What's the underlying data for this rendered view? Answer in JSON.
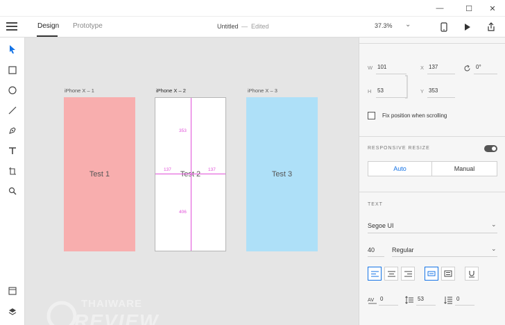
{
  "window": {
    "minimize_glyph": "—",
    "maximize_glyph": "☐",
    "close_glyph": "✕"
  },
  "toolbar": {
    "tabs": [
      {
        "label": "Design"
      },
      {
        "label": "Prototype"
      }
    ],
    "document_title": "Untitled",
    "title_separator": "—",
    "document_status": "Edited",
    "zoom": "37.3%",
    "zoom_chevron": "⌄"
  },
  "tools": [
    "select-icon",
    "rectangle-icon",
    "ellipse-icon",
    "line-icon",
    "pen-icon",
    "text-icon",
    "artboard-icon",
    "zoom-icon",
    "assets-icon",
    "layers-icon"
  ],
  "canvas": {
    "artboards": [
      {
        "name": "iPhone X – 1",
        "text": "Test 1",
        "color": "#f8aeae"
      },
      {
        "name": "iPhone X – 2",
        "text": "Test 2",
        "color": "#ffffff"
      },
      {
        "name": "iPhone X – 3",
        "text": "Test 3",
        "color": "#aee0f8"
      }
    ],
    "measurements": {
      "top": "353",
      "left": "137",
      "right": "137",
      "bottom": "406"
    },
    "guide_color": "#e14fd8"
  },
  "watermark": {
    "top": "THAIWARE",
    "bottom": "REVIEW"
  },
  "properties": {
    "w_label": "W",
    "w_value": "101",
    "x_label": "X",
    "x_value": "137",
    "rotation_value": "0°",
    "h_label": "H",
    "h_value": "53",
    "y_label": "Y",
    "y_value": "353",
    "fix_position_label": "Fix position when scrolling",
    "fix_position_checked": false,
    "responsive_heading": "RESPONSIVE RESIZE",
    "responsive_enabled": true,
    "resize_auto": "Auto",
    "resize_manual": "Manual",
    "text_heading": "TEXT",
    "font_family": "Segoe UI",
    "font_size": "40",
    "font_weight": "Regular",
    "char_spacing": "0",
    "line_spacing": "53",
    "paragraph_spacing": "0",
    "chevron": "⌄",
    "accent_color": "#1473e6"
  }
}
